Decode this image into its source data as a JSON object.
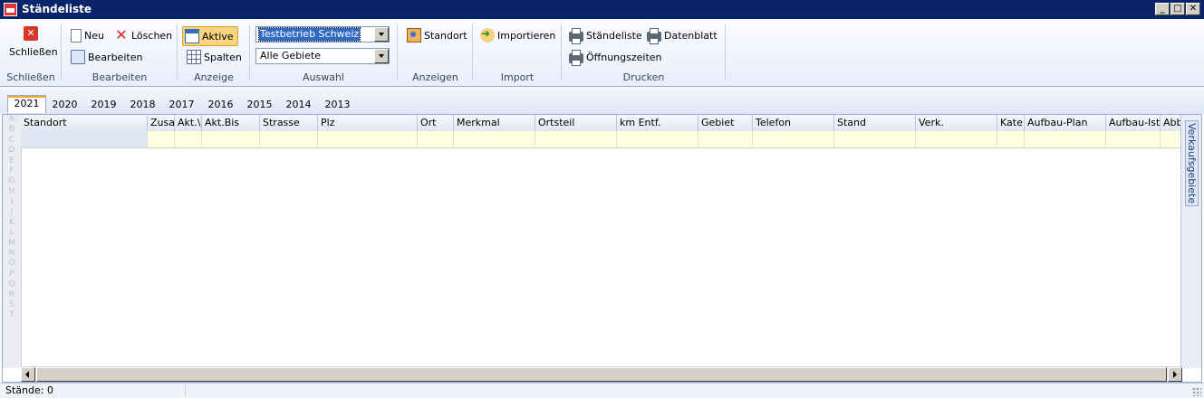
{
  "window": {
    "title": "Ständeliste"
  },
  "ribbon": {
    "schliessen": {
      "button": "Schließen",
      "group": "Schließen"
    },
    "bearbeiten": {
      "neu": "Neu",
      "loeschen": "Löschen",
      "bearbeiten": "Bearbeiten",
      "group": "Bearbeiten"
    },
    "anzeige": {
      "aktive": "Aktive",
      "spalten": "Spalten",
      "group": "Anzeige"
    },
    "auswahl": {
      "betrieb": "Testbetrieb Schweiz",
      "gebiet": "Alle Gebiete",
      "group": "Auswahl"
    },
    "anzeigen": {
      "standort": "Standort",
      "group": "Anzeigen"
    },
    "import": {
      "importieren": "Importieren",
      "group": "Import"
    },
    "drucken": {
      "staendeliste": "Ständeliste",
      "datenblatt": "Datenblatt",
      "oeffnungszeiten": "Öffnungszeiten",
      "group": "Drucken"
    }
  },
  "tabs": [
    "2021",
    "2020",
    "2019",
    "2018",
    "2017",
    "2016",
    "2015",
    "2014",
    "2013"
  ],
  "active_tab": "2021",
  "alphabet": [
    "A",
    "B",
    "C",
    "D",
    "E",
    "F",
    "G",
    "H",
    "I",
    "J",
    "K",
    "L",
    "M",
    "N",
    "O",
    "P",
    "Q",
    "R",
    "S",
    "T"
  ],
  "columns": [
    "Standort",
    "Zusa",
    "Akt.\\",
    "Akt.Bis",
    "Strasse",
    "Plz",
    "Ort",
    "Merkmal",
    "Ortsteil",
    "km Entf.",
    "Gebiet",
    "Telefon",
    "Stand",
    "Verk.",
    "Kate",
    "Aufbau-Plan",
    "Aufbau-Ist",
    "Abb"
  ],
  "side_panel": {
    "label": "Verkaufsgebiete"
  },
  "status": {
    "text": "Stände: 0"
  },
  "colors": {
    "title_bar": "#0a246a",
    "highlight": "#fbd57d",
    "filter_row": "#ffffe1"
  }
}
